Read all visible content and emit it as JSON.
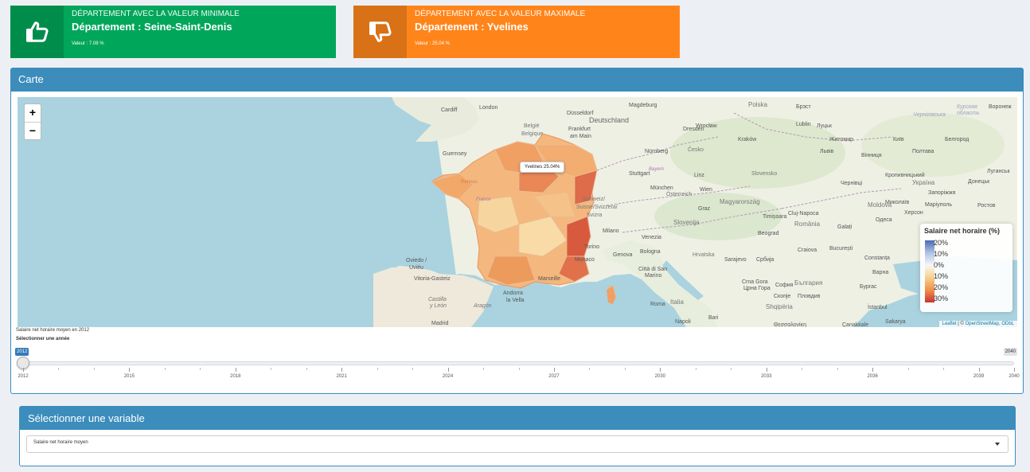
{
  "min_box": {
    "subtitle": "DÉPARTEMENT AVEC LA VALEUR MINIMALE",
    "title": "Département : Seine-Saint-Denis",
    "value": "Valeur : 7.08 %",
    "icon": "thumbs-up-icon",
    "color": "#00a65a"
  },
  "max_box": {
    "subtitle": "DÉPARTEMENT AVEC LA VALEUR MAXIMALE",
    "title": "Département : Yvelines",
    "value": "Valeur : 25.04 %",
    "icon": "thumbs-down-icon",
    "color": "#ff851b"
  },
  "map_box": {
    "title": "Carte",
    "zoom_in": "+",
    "zoom_out": "−",
    "tooltip": "Yvelines 25.04%",
    "legend": {
      "title": "Salaire net horaire (%)",
      "labels": [
        "20%",
        "10%",
        "0%",
        "10%",
        "20%",
        "30%"
      ]
    },
    "attribution_leaflet": "Leaflet",
    "attribution_sep": " | © ",
    "attribution_osm": "OpenStreetMap, ODbL",
    "caption": "Salaire net horaire moyen en 2012",
    "slider_label": "Sélectionner une année",
    "slider": {
      "min": 2012,
      "max": 2040,
      "value": 2012,
      "value_label": "2012",
      "max_label": "2040",
      "tick_labels": [
        "2012",
        "2015",
        "2018",
        "2021",
        "2024",
        "2027",
        "2030",
        "2033",
        "2036",
        "2039",
        "2040"
      ]
    }
  },
  "variable_box": {
    "title": "Sélectionner une variable",
    "selected": "Salaire net horaire moyen"
  },
  "colors": {
    "primary": "#3c8dbc",
    "success": "#00a65a",
    "warning": "#ff851b",
    "sea": "#aad3df",
    "land": "#eef0e4"
  }
}
